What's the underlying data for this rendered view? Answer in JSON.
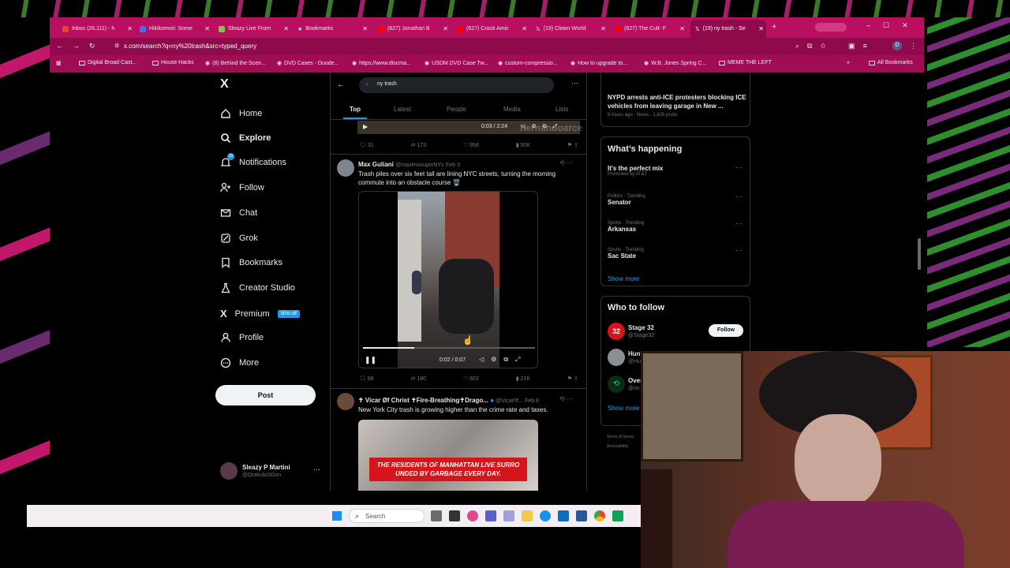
{
  "tabs": [
    {
      "label": "Inbox (26,111) - h",
      "color": "#ea4335"
    },
    {
      "label": "Hikikomori: Some",
      "color": "#4a6cf7"
    },
    {
      "label": "Sleazy Live From",
      "color": "#8bc34a"
    },
    {
      "label": "Bookmarks",
      "color": "#fbe3ef"
    },
    {
      "label": "(627) Jonathan B",
      "color": "#ff0000"
    },
    {
      "label": "(627) Crack Amic",
      "color": "#ff0000"
    },
    {
      "label": "(19) Clown World",
      "color": "#ffffff"
    },
    {
      "label": "(627) The Cult- F",
      "color": "#ff0000"
    },
    {
      "label": "(19) ny trash - Se",
      "color": "#ffffff"
    }
  ],
  "address": {
    "url": "x.com/search?q=ny%20trash&src=typed_query"
  },
  "bookmarks": [
    {
      "label": "Digital Broad Cast..."
    },
    {
      "label": "House Hacks"
    },
    {
      "label": "(8) Behind the Scen..."
    },
    {
      "label": "DVD Cases - Duode..."
    },
    {
      "label": "https://www.discma..."
    },
    {
      "label": "USDM DVD Case Tw..."
    },
    {
      "label": "custom-compressio..."
    },
    {
      "label": "How to upgrade to..."
    },
    {
      "label": "W.B. Jones Spring C..."
    },
    {
      "label": "MEME THE LEFT"
    },
    {
      "label": "All Bookmarks"
    }
  ],
  "sidebar": {
    "logo": "X",
    "items": [
      {
        "label": "Home"
      },
      {
        "label": "Explore"
      },
      {
        "label": "Notifications"
      },
      {
        "label": "Follow"
      },
      {
        "label": "Chat"
      },
      {
        "label": "Grok"
      },
      {
        "label": "Bookmarks"
      },
      {
        "label": "Creator Studio"
      },
      {
        "label": "Premium"
      },
      {
        "label": "Profile"
      },
      {
        "label": "More"
      }
    ],
    "premium_badge": "50% off",
    "notif_badge": "19",
    "post_label": "Post",
    "account": {
      "name": "Sleazy P Martini",
      "handle": "@DrakulichDon"
    }
  },
  "search": {
    "query": "ny trash",
    "tabs": [
      "Top",
      "Latest",
      "People",
      "Media",
      "Lists"
    ]
  },
  "feed": {
    "first": {
      "time": "0:03 / 2:24",
      "watermark": "hernandoarce",
      "replies": "31",
      "reposts": "173",
      "likes": "958",
      "views": "50K"
    },
    "tweet1": {
      "name": "Max Guliani",
      "handle": "@maximusupinNYc",
      "date": "Feb 3",
      "text": "Trash piles over six feet tall are lining NYC streets, turning the morning commute into an obstacle course 🗑️",
      "time": "0:02 / 0:07",
      "progress": 0.3,
      "replies": "88",
      "reposts": "180",
      "likes": "602",
      "views": "21K"
    },
    "tweet2": {
      "name": "✝ Vicar Øf Christ ✝Fire-Breathing✝Drago...",
      "handle": "@Vicar0f...",
      "date": "Feb 8",
      "text": "New York City trash is growing higher than the crime rate and taxes.",
      "caption": "THE RESIDENTS OF MANHATTAN LIVE SURRO UNDED BY GARBAGE EVERY DAY."
    }
  },
  "right": {
    "news": {
      "text": "NYPD arrests anti-ICE protesters blocking ICE vehicles from leaving garage in New ...",
      "meta": "9 hours ago · News · 1,826 posts"
    },
    "happening_title": "What’s happening",
    "trends": [
      {
        "small": "",
        "big": "It's the perfect mix",
        "sub": "Promoted by AT&T"
      },
      {
        "small": "Politics · Trending",
        "big": "Senator",
        "sub": ""
      },
      {
        "small": "Sports · Trending",
        "big": "Arkansas",
        "sub": ""
      },
      {
        "small": "Sports · Trending",
        "big": "Sac State",
        "sub": ""
      }
    ],
    "show_more": "Show more",
    "who_title": "Who to follow",
    "follow_accounts": [
      {
        "name": "Stage 32",
        "handle": "@Stage32"
      },
      {
        "name": "Hun",
        "handle": "@Hu"
      },
      {
        "name": "Over",
        "handle": "@ov"
      }
    ],
    "follow_label": "Follow",
    "show_more2": "Show more",
    "footer1": "Terms of Servic",
    "footer2": "Accessibility"
  },
  "taskbar": {
    "search": "Search"
  }
}
